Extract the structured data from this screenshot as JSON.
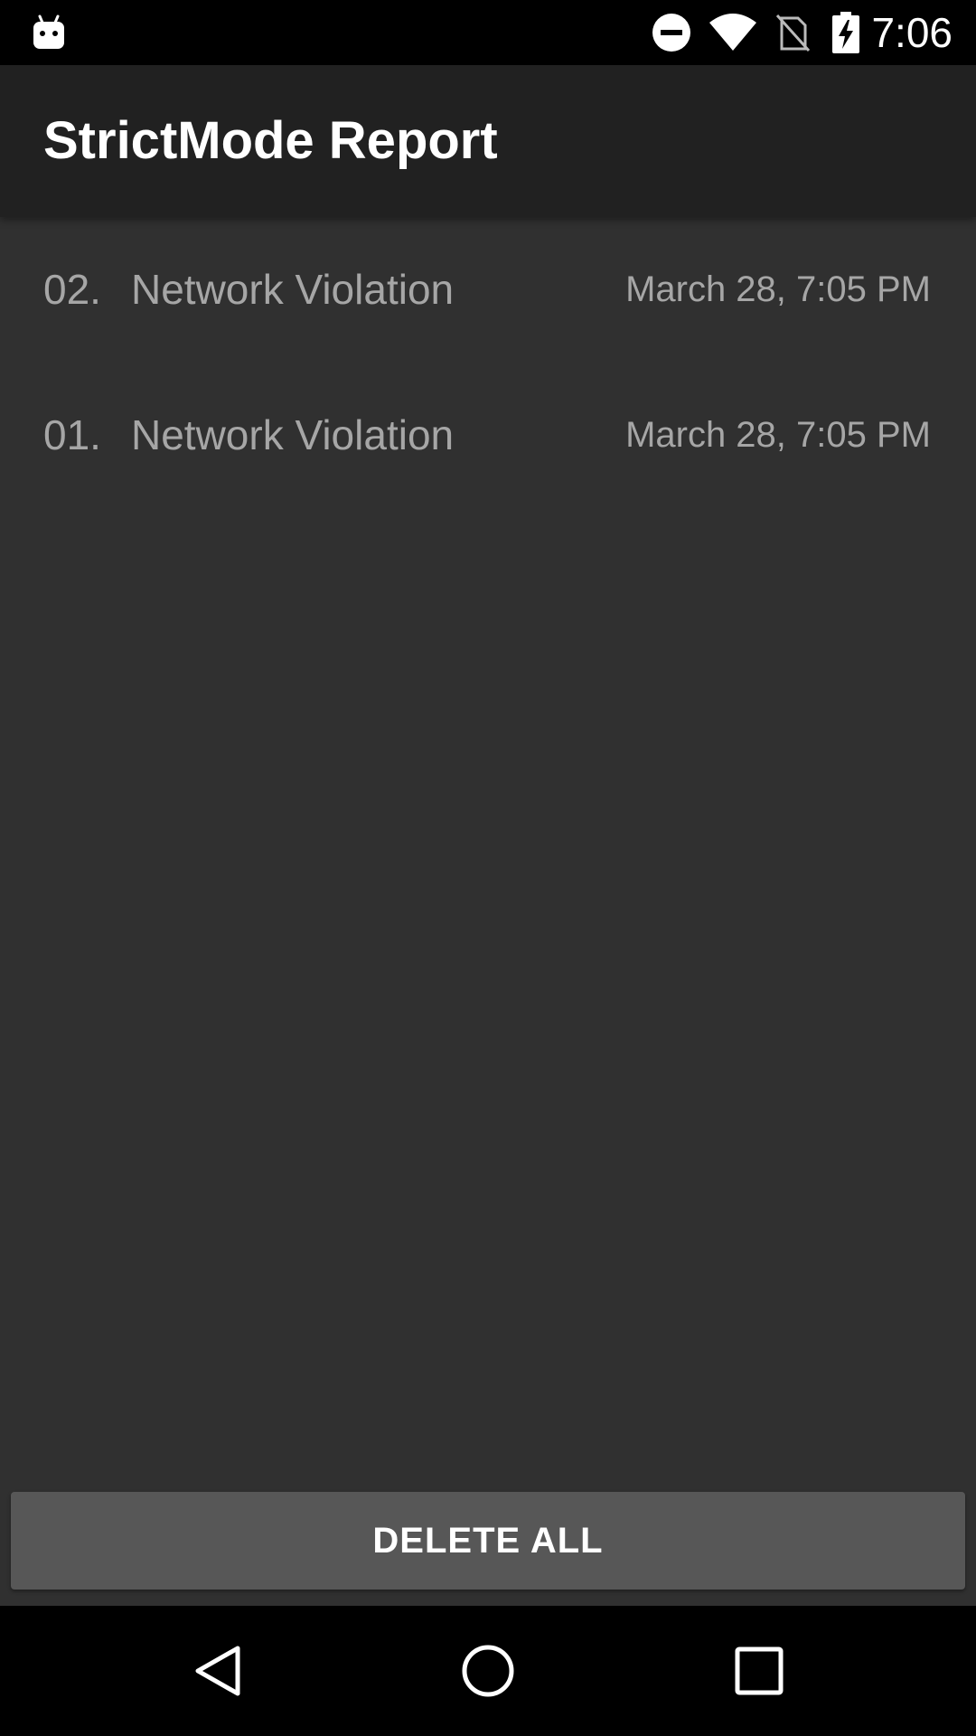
{
  "status_bar": {
    "time": "7:06",
    "icons": [
      "android-notification-icon",
      "do-not-disturb-icon",
      "wifi-icon",
      "no-sim-icon",
      "battery-charging-icon"
    ]
  },
  "app_bar": {
    "title": "StrictMode Report"
  },
  "violations": [
    {
      "index": "02.",
      "title": "Network Violation",
      "date": "March 28, 7:05 PM"
    },
    {
      "index": "01.",
      "title": "Network Violation",
      "date": "March 28, 7:05 PM"
    }
  ],
  "actions": {
    "delete_all_label": "DELETE ALL"
  },
  "nav_bar": {
    "buttons": [
      "back-icon",
      "home-icon",
      "recents-icon"
    ]
  },
  "colors": {
    "background": "#303030",
    "app_bar": "#212121",
    "button": "#575757",
    "list_text": "#a6a6a6"
  }
}
